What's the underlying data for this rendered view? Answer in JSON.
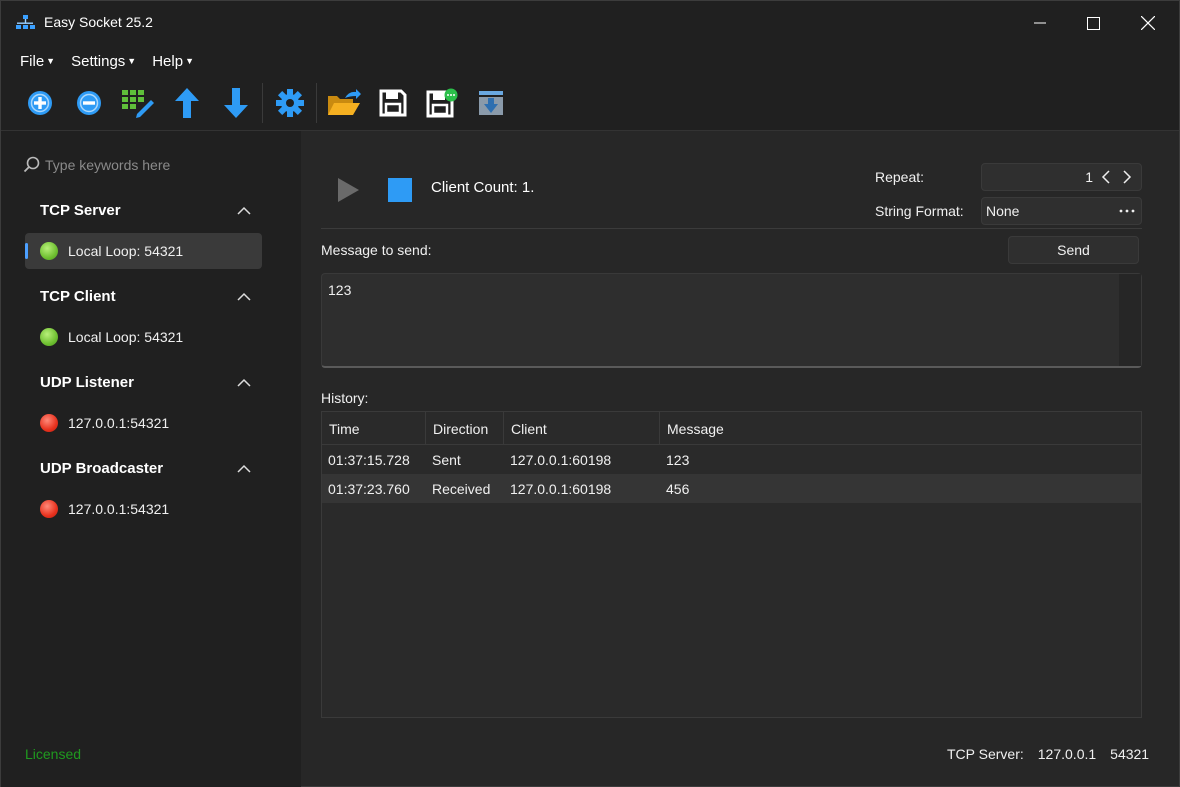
{
  "window": {
    "title": "Easy Socket 25.2"
  },
  "menu": [
    {
      "label": "File"
    },
    {
      "label": "Settings"
    },
    {
      "label": "Help"
    }
  ],
  "toolbar": {
    "icons": [
      "add-icon",
      "remove-icon",
      "edit-grid-icon",
      "move-up-icon",
      "move-down-icon",
      "settings-gear-icon",
      "open-folder-icon",
      "save-icon",
      "save-as-icon",
      "import-icon"
    ]
  },
  "sidebar": {
    "search_placeholder": "Type keywords here",
    "groups": [
      {
        "label": "TCP Server",
        "items": [
          {
            "label": "Local Loop: 54321",
            "status": "green",
            "selected": true
          }
        ]
      },
      {
        "label": "TCP Client",
        "items": [
          {
            "label": "Local Loop: 54321",
            "status": "green"
          }
        ]
      },
      {
        "label": "UDP Listener",
        "items": [
          {
            "label": "127.0.0.1:54321",
            "status": "red"
          }
        ]
      },
      {
        "label": "UDP Broadcaster",
        "items": [
          {
            "label": "127.0.0.1:54321",
            "status": "red"
          }
        ]
      }
    ],
    "license_text": "Licensed"
  },
  "main": {
    "client_count": "Client Count: 1.",
    "repeat_label": "Repeat:",
    "repeat_value": "1",
    "string_format_label": "String Format:",
    "string_format_value": "None",
    "message_label": "Message to send:",
    "send_label": "Send",
    "message_text": "123",
    "history_label": "History:",
    "history": {
      "columns": [
        "Time",
        "Direction",
        "Client",
        "Message"
      ],
      "rows": [
        [
          "01:37:15.728",
          "Sent",
          "127.0.0.1:60198",
          "123"
        ],
        [
          "01:37:23.760",
          "Received",
          "127.0.0.1:60198",
          "456"
        ]
      ]
    }
  },
  "statusbar": {
    "mode": "TCP Server:",
    "address": "127.0.0.1",
    "port": "54321"
  },
  "colors": {
    "accent_blue": "#2e9bf5",
    "status_green": "#6fc031",
    "status_red": "#e8321e",
    "licensed_green": "#1f9a1f"
  }
}
